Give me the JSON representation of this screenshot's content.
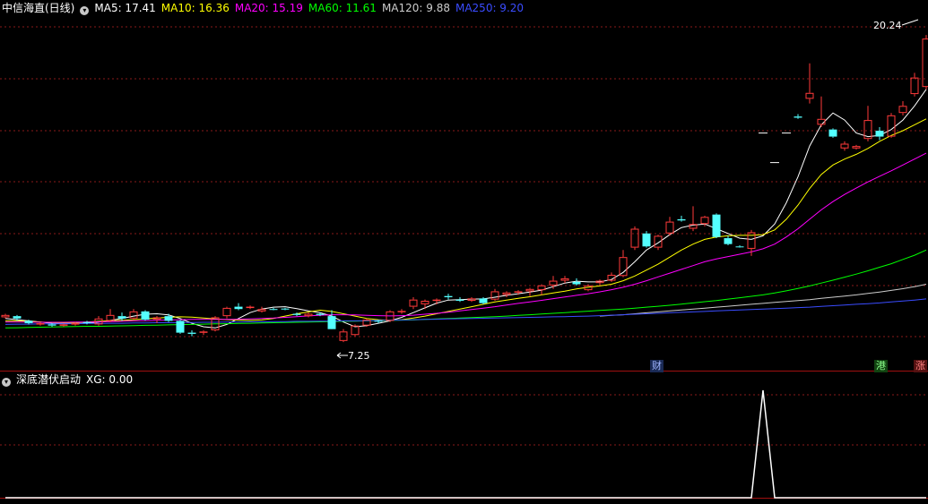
{
  "header": {
    "title": "中信海直(日线)",
    "ma": [
      {
        "label": "MA5: 17.41",
        "color": "#ffffff"
      },
      {
        "label": "MA10: 16.36",
        "color": "#ffff00"
      },
      {
        "label": "MA20: 15.19",
        "color": "#ff00ff"
      },
      {
        "label": "MA60: 11.61",
        "color": "#00ff00"
      },
      {
        "label": "MA120: 9.88",
        "color": "#cccccc"
      },
      {
        "label": "MA250: 9.20",
        "color": "#3a4cff"
      }
    ]
  },
  "indicator": {
    "title": "深底潜伏启动",
    "value_label": "XG: 0.00"
  },
  "annotations": {
    "high_label": "20.24",
    "low_label": "7.25",
    "badges": [
      {
        "text": "财",
        "color": "#9fb4ff",
        "bg": "#1a2a55"
      },
      {
        "text": "港",
        "color": "#8cff8c",
        "bg": "#114411"
      },
      {
        "text": "涨",
        "color": "#ff8080",
        "bg": "#551111"
      }
    ]
  },
  "colors": {
    "up": "#ff3a3a",
    "down": "#54ffff",
    "grid": "#8a1a1a",
    "divider": "#a01010"
  },
  "chart_data": [
    {
      "type": "candlestick",
      "title": "中信海直(日线)",
      "ylim": [
        6.6,
        21.0
      ],
      "candles": [
        [
          8.25,
          8.4,
          8.2,
          8.35
        ],
        [
          8.3,
          8.35,
          8.1,
          8.2
        ],
        [
          8.1,
          8.15,
          7.95,
          8.0
        ],
        [
          7.95,
          8.05,
          7.9,
          8.0
        ],
        [
          7.95,
          8.0,
          7.85,
          7.9
        ],
        [
          7.9,
          7.98,
          7.85,
          7.95
        ],
        [
          7.95,
          8.05,
          7.9,
          8.0
        ],
        [
          8.05,
          8.1,
          7.95,
          8.0
        ],
        [
          7.95,
          8.3,
          7.9,
          8.2
        ],
        [
          8.1,
          8.6,
          8.05,
          8.35
        ],
        [
          8.3,
          8.45,
          8.1,
          8.2
        ],
        [
          8.2,
          8.6,
          8.15,
          8.5
        ],
        [
          8.5,
          8.55,
          8.1,
          8.15
        ],
        [
          8.15,
          8.3,
          8.0,
          8.25
        ],
        [
          8.3,
          8.4,
          8.05,
          8.1
        ],
        [
          8.1,
          8.15,
          7.55,
          7.6
        ],
        [
          7.6,
          7.7,
          7.45,
          7.55
        ],
        [
          7.6,
          7.7,
          7.5,
          7.65
        ],
        [
          7.7,
          8.3,
          7.65,
          8.25
        ],
        [
          8.3,
          8.7,
          8.2,
          8.65
        ],
        [
          8.7,
          8.85,
          8.55,
          8.6
        ],
        [
          8.65,
          8.75,
          8.6,
          8.7
        ],
        [
          8.5,
          8.7,
          8.45,
          8.6
        ],
        [
          8.6,
          8.65,
          8.55,
          8.58
        ],
        [
          8.62,
          8.65,
          8.55,
          8.58
        ],
        [
          8.4,
          8.45,
          8.3,
          8.35
        ],
        [
          8.3,
          8.45,
          8.25,
          8.4
        ],
        [
          8.4,
          8.45,
          8.3,
          8.35
        ],
        [
          8.3,
          8.55,
          8.1,
          7.75
        ],
        [
          7.25,
          7.75,
          7.2,
          7.65
        ],
        [
          7.5,
          7.95,
          7.45,
          7.9
        ],
        [
          7.9,
          8.2,
          7.85,
          8.15
        ],
        [
          8.1,
          8.15,
          8.0,
          8.08
        ],
        [
          8.1,
          8.55,
          8.05,
          8.5
        ],
        [
          8.5,
          8.6,
          8.4,
          8.52
        ],
        [
          8.7,
          9.1,
          8.6,
          9.0
        ],
        [
          8.8,
          9.0,
          8.6,
          8.95
        ],
        [
          8.95,
          9.05,
          8.8,
          9.0
        ],
        [
          9.15,
          9.25,
          9.0,
          9.1
        ],
        [
          9.0,
          9.1,
          8.9,
          8.95
        ],
        [
          8.95,
          9.1,
          8.9,
          9.05
        ],
        [
          9.05,
          9.1,
          8.8,
          8.85
        ],
        [
          9.0,
          9.45,
          8.95,
          9.35
        ],
        [
          9.2,
          9.35,
          9.1,
          9.3
        ],
        [
          9.3,
          9.4,
          9.2,
          9.35
        ],
        [
          9.35,
          9.5,
          9.15,
          9.45
        ],
        [
          9.4,
          9.65,
          9.2,
          9.6
        ],
        [
          9.6,
          10.0,
          9.45,
          9.8
        ],
        [
          9.8,
          10.0,
          9.7,
          9.9
        ],
        [
          9.75,
          9.9,
          9.6,
          9.65
        ],
        [
          9.4,
          9.65,
          9.35,
          9.6
        ],
        [
          9.7,
          9.85,
          9.6,
          9.8
        ],
        [
          9.8,
          10.15,
          9.75,
          10.05
        ],
        [
          10.0,
          11.1,
          9.95,
          10.8
        ],
        [
          11.2,
          12.1,
          11.1,
          12.0
        ],
        [
          11.8,
          11.9,
          11.2,
          11.25
        ],
        [
          11.2,
          11.75,
          11.1,
          11.7
        ],
        [
          11.8,
          12.5,
          11.7,
          12.3
        ],
        [
          12.4,
          12.55,
          12.3,
          12.35
        ],
        [
          12.0,
          12.95,
          11.9,
          12.2
        ],
        [
          12.2,
          12.55,
          12.1,
          12.5
        ],
        [
          12.6,
          12.65,
          11.6,
          11.65
        ],
        [
          11.6,
          11.7,
          11.3,
          11.35
        ],
        [
          11.25,
          11.3,
          11.2,
          11.22
        ],
        [
          11.15,
          11.95,
          10.85,
          11.85
        ],
        [
          null,
          null,
          null,
          null
        ],
        [
          null,
          null,
          null,
          null
        ],
        [
          null,
          null,
          null,
          null
        ],
        [
          16.75,
          16.85,
          16.65,
          16.7
        ],
        [
          17.5,
          19.0,
          17.3,
          17.75
        ],
        [
          16.4,
          17.6,
          16.3,
          16.65
        ],
        [
          16.2,
          16.25,
          15.85,
          15.9
        ],
        [
          15.4,
          15.7,
          15.3,
          15.6
        ],
        [
          15.4,
          15.55,
          15.35,
          15.5
        ],
        [
          15.8,
          17.2,
          15.7,
          16.6
        ],
        [
          16.15,
          16.3,
          15.75,
          15.9
        ],
        [
          15.9,
          16.9,
          15.85,
          16.8
        ],
        [
          16.9,
          17.4,
          16.8,
          17.2
        ],
        [
          17.7,
          18.6,
          17.6,
          18.4
        ],
        [
          18.0,
          20.2,
          17.9,
          20.05
        ]
      ],
      "markers": [
        [
          65,
          16.05,
          16.2
        ],
        [
          66,
          14.8,
          15.0
        ],
        [
          67,
          16.05,
          16.05
        ]
      ],
      "series": [
        {
          "name": "MA5",
          "color": "#ffffff",
          "values": [
            8.2,
            8.15,
            8.1,
            8.05,
            8.0,
            7.98,
            7.99,
            8.0,
            8.05,
            8.12,
            8.2,
            8.3,
            8.38,
            8.4,
            8.35,
            8.2,
            8.0,
            7.85,
            7.8,
            7.95,
            8.2,
            8.45,
            8.6,
            8.68,
            8.7,
            8.62,
            8.52,
            8.45,
            8.3,
            8.05,
            7.85,
            7.9,
            8.0,
            8.1,
            8.25,
            8.45,
            8.65,
            8.85,
            8.98,
            9.0,
            9.02,
            9.03,
            9.1,
            9.18,
            9.25,
            9.32,
            9.4,
            9.55,
            9.7,
            9.78,
            9.75,
            9.75,
            9.85,
            10.15,
            10.6,
            11.1,
            11.4,
            11.75,
            12.05,
            12.15,
            12.2,
            12.0,
            11.8,
            11.6,
            11.55,
            11.7,
            12.2,
            13.1,
            14.2,
            15.5,
            16.4,
            16.9,
            16.6,
            16.05,
            15.9,
            15.95,
            16.2,
            16.6,
            17.2,
            17.9
          ]
        },
        {
          "name": "MA10",
          "color": "#ffff00",
          "values": [
            8.1,
            8.1,
            8.08,
            8.05,
            8.03,
            8.02,
            8.03,
            8.05,
            8.08,
            8.1,
            8.12,
            8.15,
            8.18,
            8.22,
            8.25,
            8.27,
            8.26,
            8.22,
            8.18,
            8.15,
            8.13,
            8.12,
            8.14,
            8.2,
            8.3,
            8.4,
            8.48,
            8.55,
            8.5,
            8.4,
            8.3,
            8.2,
            8.15,
            8.12,
            8.15,
            8.22,
            8.3,
            8.4,
            8.5,
            8.6,
            8.7,
            8.8,
            8.9,
            8.98,
            9.05,
            9.12,
            9.2,
            9.28,
            9.36,
            9.45,
            9.52,
            9.58,
            9.65,
            9.8,
            10.0,
            10.25,
            10.5,
            10.8,
            11.1,
            11.35,
            11.55,
            11.65,
            11.7,
            11.72,
            11.72,
            11.75,
            11.95,
            12.4,
            13.0,
            13.7,
            14.3,
            14.7,
            14.95,
            15.15,
            15.4,
            15.7,
            15.95,
            16.15,
            16.4,
            16.65
          ]
        },
        {
          "name": "MA20",
          "color": "#ff00ff",
          "values": [
            8.05,
            8.05,
            8.05,
            8.04,
            8.04,
            8.04,
            8.05,
            8.05,
            8.06,
            8.07,
            8.08,
            8.1,
            8.11,
            8.12,
            8.14,
            8.15,
            8.16,
            8.16,
            8.16,
            8.16,
            8.17,
            8.18,
            8.2,
            8.22,
            8.25,
            8.28,
            8.31,
            8.34,
            8.36,
            8.36,
            8.35,
            8.33,
            8.32,
            8.31,
            8.32,
            8.34,
            8.38,
            8.42,
            8.47,
            8.52,
            8.58,
            8.64,
            8.7,
            8.77,
            8.84,
            8.9,
            8.97,
            9.04,
            9.11,
            9.18,
            9.25,
            9.33,
            9.42,
            9.52,
            9.65,
            9.8,
            9.96,
            10.12,
            10.28,
            10.44,
            10.6,
            10.72,
            10.82,
            10.92,
            11.02,
            11.15,
            11.35,
            11.65,
            12.0,
            12.4,
            12.8,
            13.15,
            13.45,
            13.72,
            13.98,
            14.22,
            14.45,
            14.7,
            14.95,
            15.2
          ]
        },
        {
          "name": "MA60",
          "color": "#00ff00",
          "values": [
            7.8,
            7.81,
            7.82,
            7.83,
            7.84,
            7.85,
            7.86,
            7.87,
            7.87,
            7.88,
            7.89,
            7.9,
            7.91,
            7.92,
            7.93,
            7.94,
            7.95,
            7.96,
            7.97,
            7.98,
            7.99,
            8.0,
            8.01,
            8.02,
            8.03,
            8.04,
            8.05,
            8.06,
            8.07,
            8.08,
            8.09,
            8.1,
            8.11,
            8.12,
            8.13,
            8.14,
            8.16,
            8.18,
            8.2,
            8.22,
            8.24,
            8.26,
            8.28,
            8.3,
            8.33,
            8.36,
            8.39,
            8.42,
            8.45,
            8.48,
            8.51,
            8.54,
            8.57,
            8.6,
            8.64,
            8.68,
            8.72,
            8.76,
            8.81,
            8.86,
            8.91,
            8.96,
            9.02,
            9.08,
            9.14,
            9.2,
            9.28,
            9.37,
            9.47,
            9.58,
            9.7,
            9.82,
            9.95,
            10.08,
            10.22,
            10.37,
            10.52,
            10.7,
            10.88,
            11.1
          ]
        },
        {
          "name": "MA120",
          "color": "#cccccc",
          "values": [
            null,
            null,
            null,
            null,
            null,
            null,
            null,
            null,
            null,
            null,
            null,
            null,
            null,
            null,
            null,
            null,
            null,
            null,
            null,
            null,
            null,
            null,
            null,
            null,
            null,
            null,
            null,
            null,
            null,
            null,
            null,
            null,
            null,
            null,
            null,
            null,
            null,
            null,
            null,
            null,
            null,
            null,
            null,
            null,
            null,
            null,
            null,
            null,
            null,
            null,
            null,
            8.3,
            8.33,
            8.36,
            8.4,
            8.44,
            8.48,
            8.52,
            8.56,
            8.6,
            8.64,
            8.68,
            8.72,
            8.76,
            8.8,
            8.84,
            8.88,
            8.92,
            8.96,
            9.0,
            9.05,
            9.1,
            9.15,
            9.2,
            9.26,
            9.32,
            9.39,
            9.46,
            9.55,
            9.65
          ]
        },
        {
          "name": "MA250",
          "color": "#3a4cff",
          "values": [
            7.95,
            7.96,
            7.96,
            7.97,
            7.97,
            7.98,
            7.98,
            7.99,
            7.99,
            8.0,
            8.0,
            8.01,
            8.01,
            8.02,
            8.02,
            8.03,
            8.03,
            8.04,
            8.04,
            8.05,
            8.05,
            8.06,
            8.06,
            8.07,
            8.07,
            8.08,
            8.08,
            8.09,
            8.09,
            8.1,
            8.1,
            8.11,
            8.12,
            8.13,
            8.14,
            8.15,
            8.16,
            8.17,
            8.18,
            8.19,
            8.2,
            8.21,
            8.22,
            8.23,
            8.24,
            8.25,
            8.26,
            8.27,
            8.28,
            8.29,
            8.3,
            8.32,
            8.34,
            8.36,
            8.38,
            8.4,
            8.42,
            8.44,
            8.46,
            8.48,
            8.5,
            8.52,
            8.54,
            8.56,
            8.58,
            8.6,
            8.62,
            8.64,
            8.66,
            8.68,
            8.71,
            8.74,
            8.77,
            8.8,
            8.83,
            8.86,
            8.9,
            8.94,
            8.98,
            9.03
          ]
        }
      ]
    },
    {
      "type": "line",
      "title": "深底潜伏启动",
      "series": [
        {
          "name": "XG",
          "color": "#ffffff",
          "values": [
            0,
            0,
            0,
            0,
            0,
            0,
            0,
            0,
            0,
            0,
            0,
            0,
            0,
            0,
            0,
            0,
            0,
            0,
            0,
            0,
            0,
            0,
            0,
            0,
            0,
            0,
            0,
            0,
            0,
            0,
            0,
            0,
            0,
            0,
            0,
            0,
            0,
            0,
            0,
            0,
            0,
            0,
            0,
            0,
            0,
            0,
            0,
            0,
            0,
            0,
            0,
            0,
            0,
            0,
            0,
            0,
            0,
            0,
            0,
            0,
            0,
            0,
            0,
            0,
            0,
            1,
            0,
            0,
            0,
            0,
            0,
            0,
            0,
            0,
            0,
            0,
            0,
            0,
            0,
            0
          ]
        }
      ],
      "ylim": [
        0,
        1
      ]
    }
  ]
}
